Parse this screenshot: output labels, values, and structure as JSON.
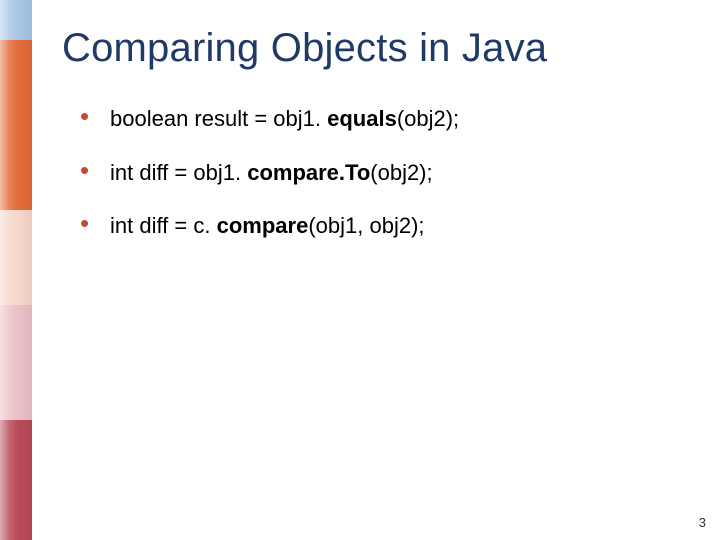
{
  "slide": {
    "title": "Comparing Objects in Java",
    "bullets": [
      {
        "pre": "boolean result = obj1. ",
        "bold": "equals",
        "post": "(obj2);"
      },
      {
        "pre": "int diff = obj1. ",
        "bold": "compare.To",
        "post": "(obj2);"
      },
      {
        "pre": "int diff = c. ",
        "bold": "compare",
        "post": "(obj1, obj2);"
      }
    ],
    "page_number": "3"
  },
  "colors": {
    "title": "#1f3a66",
    "bullet_marker": "#c24a33"
  }
}
